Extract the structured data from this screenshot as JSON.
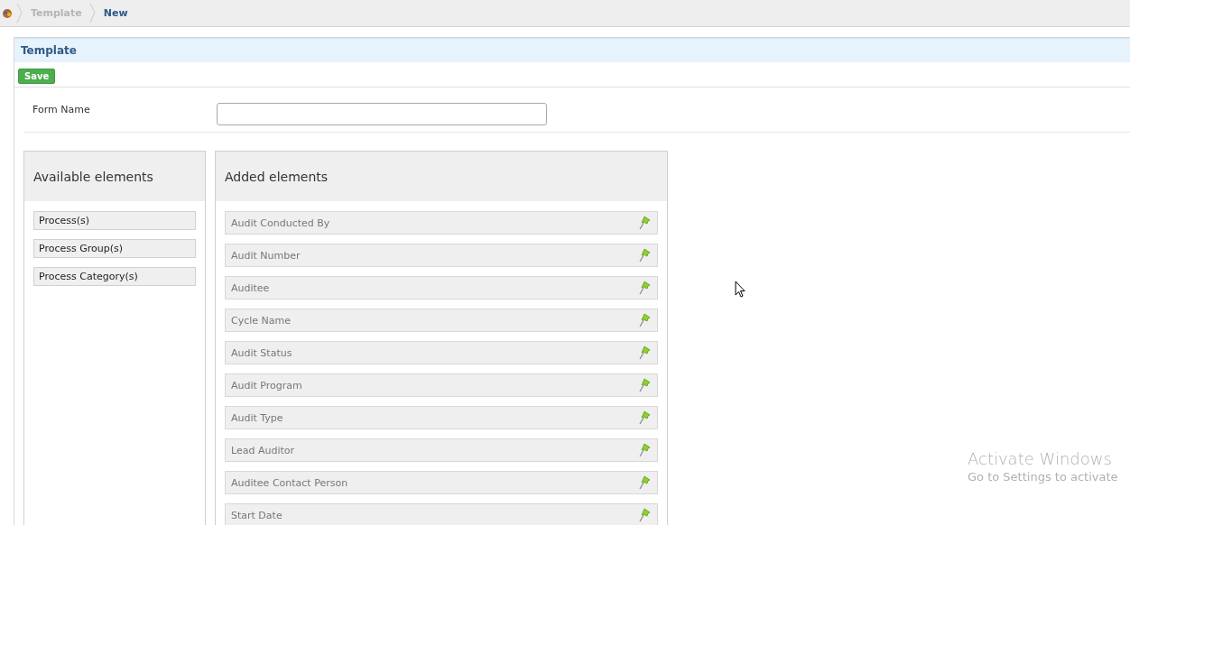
{
  "breadcrumb": [
    {
      "label": "Template",
      "selected": false
    },
    {
      "label": "New",
      "selected": true
    }
  ],
  "panel": {
    "title": "Template",
    "save_button": "Save"
  },
  "form": {
    "label": "Form Name"
  },
  "available": {
    "title": "Available elements",
    "items": [
      "Process(s)",
      "Process Group(s)",
      "Process Category(s)"
    ]
  },
  "added": {
    "title": "Added elements",
    "items": [
      "Audit Conducted By",
      "Audit Number",
      "Auditee",
      "Cycle Name",
      "Audit Status",
      "Audit Program",
      "Audit Type",
      "Lead Auditor",
      "Auditee Contact Person",
      "Start Date"
    ]
  },
  "os_notice": {
    "title": "Activate Windows",
    "text": "Go to Settings to activate"
  }
}
